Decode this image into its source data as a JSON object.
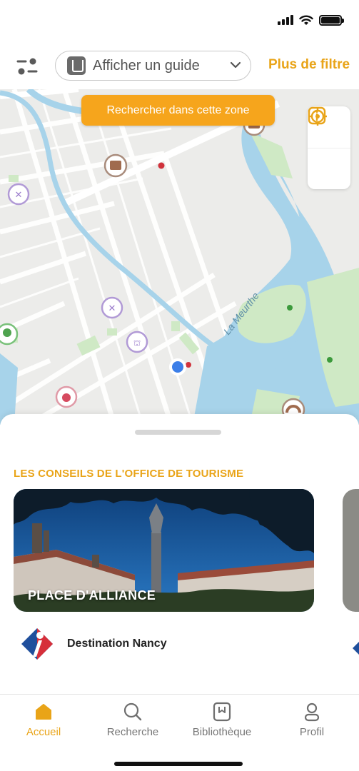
{
  "map": {
    "search_zone_label": "Rechercher dans cette zone",
    "river_label": "La Meurthe"
  },
  "top_bar": {
    "guide_select_label": "Afficher un guide",
    "more_filters_label": "Plus de filtre"
  },
  "sheet": {
    "section_title": "LES CONSEILS DE L'OFFICE DE TOURISME",
    "card": {
      "title": "PLACE D'ALLIANCE"
    },
    "source_name": "Destination Nancy"
  },
  "tabs": [
    {
      "label": "Accueil",
      "icon": "home-icon",
      "active": true
    },
    {
      "label": "Recherche",
      "icon": "search-icon",
      "active": false
    },
    {
      "label": "Bibliothèque",
      "icon": "book-icon",
      "active": false
    },
    {
      "label": "Profil",
      "icon": "user-icon",
      "active": false
    }
  ],
  "colors": {
    "accent": "#e9a418",
    "water": "#a7d3ea",
    "park": "#cfe9c5",
    "marker": "#b19ad6"
  }
}
